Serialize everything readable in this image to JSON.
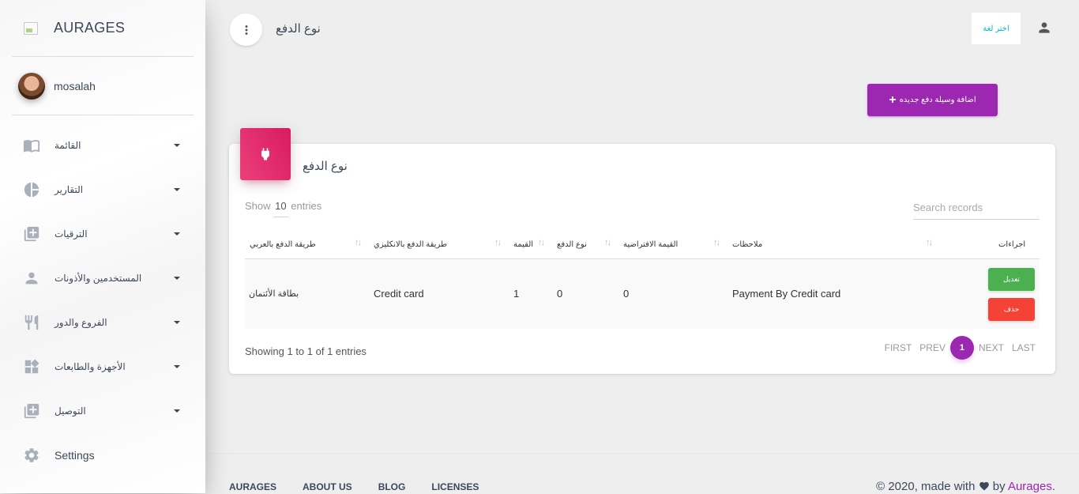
{
  "sidebar": {
    "logo_text": "AURAGES",
    "user_name": "mosalah",
    "items": [
      {
        "label": "القائمة",
        "icon": "menu-book-icon"
      },
      {
        "label": "التقارير",
        "icon": "pie-chart-icon"
      },
      {
        "label": "الترقيات",
        "icon": "library-add-icon"
      },
      {
        "label": "المستخدمين والأذونات",
        "icon": "person-icon"
      },
      {
        "label": "الفروع والدور",
        "icon": "restaurant-icon"
      },
      {
        "label": "الأجهزة والطابعات",
        "icon": "widgets-icon"
      },
      {
        "label": "التوصيل",
        "icon": "library-add-icon"
      },
      {
        "label": "Settings",
        "icon": "gear-icon"
      }
    ]
  },
  "header": {
    "title": "نوع الدفع",
    "lang_button": "اختر لغة"
  },
  "add_button": "اضافة وسيلة دفع جديده",
  "card": {
    "title": "نوع الدفع",
    "show_prefix": "Show",
    "show_count": "10",
    "show_suffix": "entries",
    "search_placeholder": "Search records",
    "columns": {
      "arabic_name": "طريقة الدفع بالعربي",
      "english_name": "طريقة الدفع بالانكليزي",
      "value": "القيمة",
      "type": "نوع الدفع",
      "default_value": "القيمة الافتراضية",
      "notes": "ملاحظات",
      "actions": "اجراءات"
    },
    "rows": [
      {
        "arabic_name": "بطاقة الأئتمان",
        "english_name": "Credit card",
        "value": "1",
        "type": "0",
        "default_value": "0",
        "notes": "Payment By Credit card",
        "edit_label": "تعديل",
        "delete_label": "حذف"
      }
    ],
    "showing_text": "Showing 1 to 1 of 1 entries",
    "pagination": {
      "first": "FIRST",
      "prev": "PREV",
      "current": "1",
      "next": "NEXT",
      "last": "LAST"
    }
  },
  "footer": {
    "links": [
      "AURAGES",
      "ABOUT US",
      "BLOG",
      "LICENSES"
    ],
    "copyright_prefix": "© 2020, made with",
    "copyright_by": "by",
    "brand": "Aurages."
  },
  "colors": {
    "primary": "#9c27b0",
    "card_icon": "#e91e63",
    "edit": "#4caf50",
    "delete": "#f44336",
    "lang_text": "#00bcd4"
  }
}
